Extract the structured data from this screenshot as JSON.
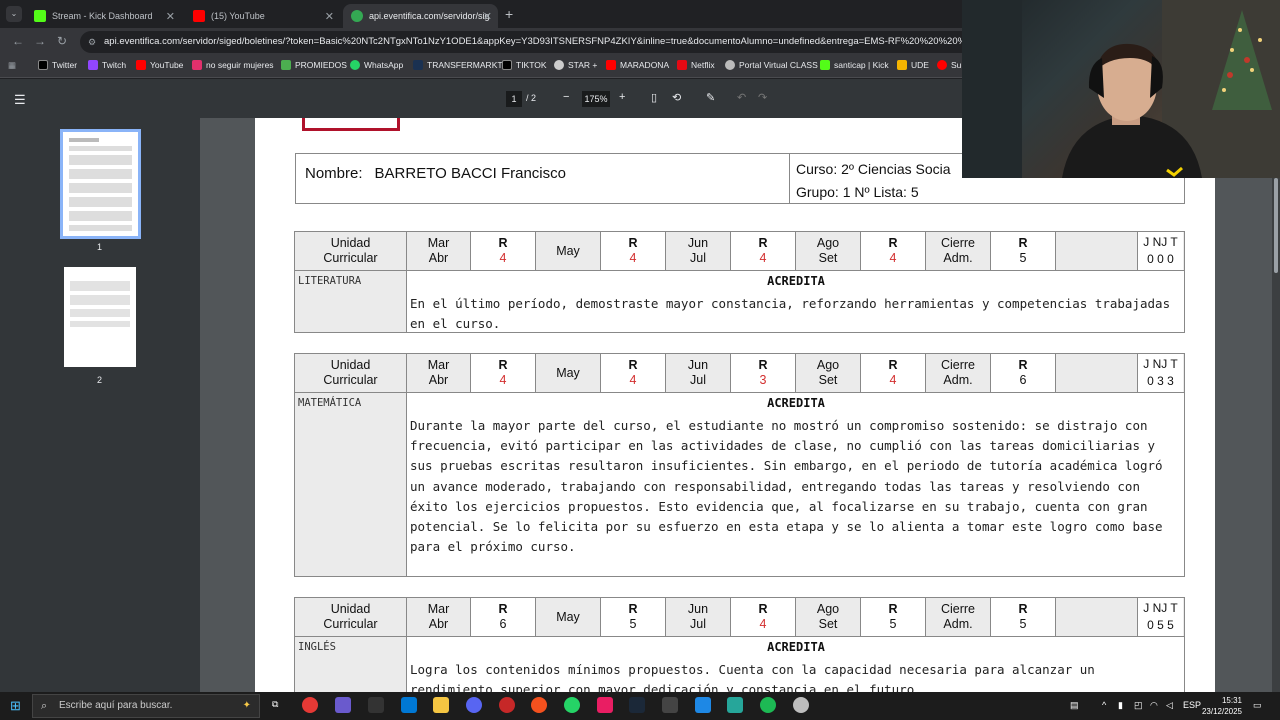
{
  "browser": {
    "tabs": [
      {
        "title": "Stream - Kick Dashboard",
        "color": "#53fc18"
      },
      {
        "title": "(15) YouTube",
        "color": "#ff0000"
      },
      {
        "title": "api.eventifica.com/servidor/sig",
        "color": "#34a853"
      }
    ],
    "url": "api.eventifica.com/servidor/siged/boletines/?token=Basic%20NTc2NTgxNTo1NzY1ODE1&appKey=Y3D93ITSNERSFNP4ZKIY&inline=true&documentoAlumno=undefined&entrega=EMS-RF%20%20%20%20%20&cu",
    "bookmarks": [
      {
        "label": "Twitter",
        "color": "#ffffff"
      },
      {
        "label": "Twitch",
        "color": "#9146ff"
      },
      {
        "label": "YouTube",
        "color": "#ff0000"
      },
      {
        "label": "no seguir mujeres",
        "color": "#e1306c"
      },
      {
        "label": "PROMIEDOS",
        "color": "#4caf50"
      },
      {
        "label": "WhatsApp",
        "color": "#25d366"
      },
      {
        "label": "TRANSFERMARKT",
        "color": "#1a3151"
      },
      {
        "label": "TIKTOK",
        "color": "#ffffff"
      },
      {
        "label": "STAR +",
        "color": "#cccccc"
      },
      {
        "label": "MARADONA",
        "color": "#ff0000"
      },
      {
        "label": "Netflix",
        "color": "#e50914"
      },
      {
        "label": "Portal Virtual CLASS",
        "color": "#bbbbbb"
      },
      {
        "label": "santicap | Kick",
        "color": "#53fc18"
      },
      {
        "label": "UDE",
        "color": "#f4b400"
      },
      {
        "label": "Su",
        "color": "#ff0000"
      }
    ]
  },
  "pdf": {
    "page_current": "1",
    "page_total": "/ 2",
    "zoom": "175%",
    "thumbnails": [
      "1",
      "2"
    ]
  },
  "student": {
    "nombre_label": "Nombre:",
    "nombre": "BARRETO BACCI Francisco",
    "curso": "Curso:  2º Ciencias Socia",
    "grupo": "Grupo:  1  Nº Lista: 5"
  },
  "header_labels": {
    "unidad": "Unidad",
    "curricular": "Curricular",
    "mar": "Mar",
    "abr": "Abr",
    "r": "R",
    "may": "May",
    "jun": "Jun",
    "jul": "Jul",
    "ago": "Ago",
    "set": "Set",
    "cierre": "Cierre",
    "adm": "Adm.",
    "jnt": "J  NJ  T"
  },
  "subjects": [
    {
      "name": "LITERATURA",
      "r1": "4",
      "r2": "4",
      "r3": "4",
      "r4": "4",
      "r5": "5",
      "jnt": "0  0  0",
      "status": "ACREDITA",
      "comment": "En el último período, demostraste mayor constancia, reforzando herramientas y competencias trabajadas en el curso."
    },
    {
      "name": "MATEMÁTICA",
      "r1": "4",
      "r2": "4",
      "r3": "3",
      "r4": "4",
      "r5": "6",
      "jnt": "0  3  3",
      "status": "ACREDITA",
      "comment": "Durante la mayor parte del curso, el estudiante no mostró un compromiso sostenido: se distrajo con frecuencia, evitó participar en las actividades de clase, no cumplió con las tareas domiciliarias y sus pruebas escritas resultaron insuficientes. Sin embargo, en el periodo de tutoría académica logró un avance moderado, trabajando con responsabilidad, entregando todas las tareas y resolviendo con éxito los ejercicios propuestos. Esto evidencia que, al focalizarse en su trabajo, cuenta con gran potencial. Se lo felicita por su esfuerzo en esta etapa y se lo alienta a tomar este logro como base para el próximo curso."
    },
    {
      "name": "INGLÉS",
      "r1": "6",
      "r2": "5",
      "r3": "4",
      "r4": "5",
      "r5": "5",
      "jnt": "0  5  5",
      "status": "ACREDITA",
      "comment": "Logra los contenidos mínimos propuestos. Cuenta con la capacidad necesaria para alcanzar un rendimiento superior con mayor dedicación y constancia en el futuro"
    }
  ],
  "taskbar": {
    "search_placeholder": "Escribe aquí para buscar.",
    "lang": "ESP",
    "time": "15:31",
    "date": "23/12/2025"
  }
}
